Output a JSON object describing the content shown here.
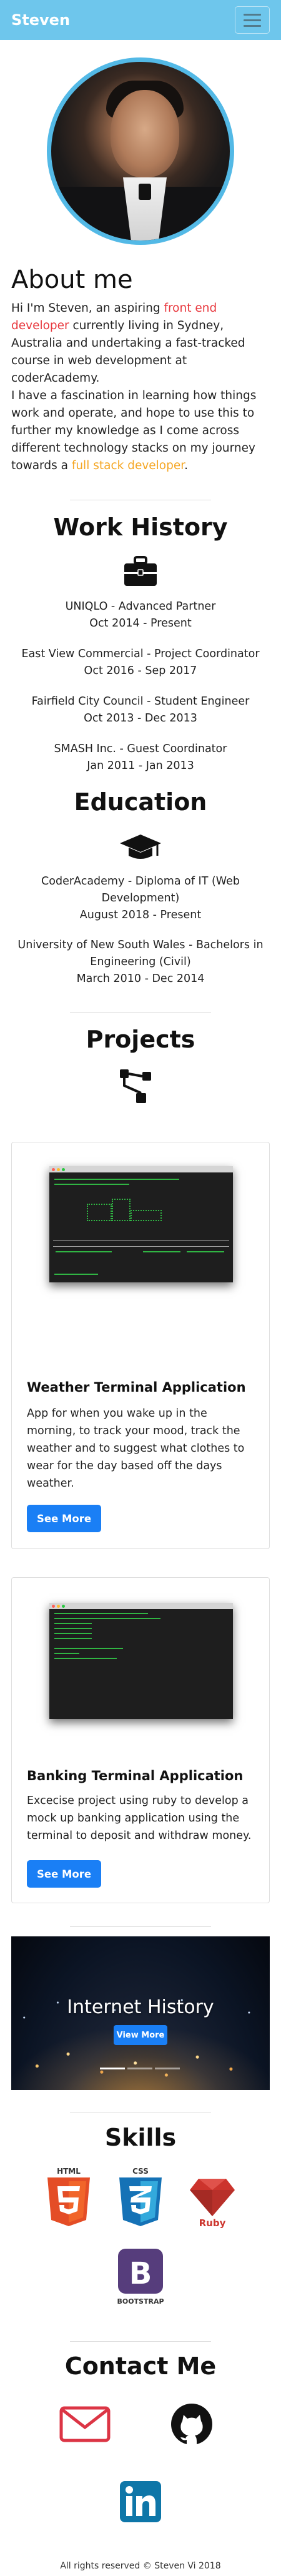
{
  "navbar": {
    "brand": "Steven"
  },
  "about": {
    "title": "About me",
    "p1_a": "Hi I'm Steven, an aspiring ",
    "p1_highlight": "front end developer",
    "p1_b": " currently living in Sydney, Australia and undertaking a fast-tracked course in web development at coderAcademy.",
    "p2_a": "I have a fascination in learning how things work and operate, and hope to use this to further my knowledge as I come across different technology stacks on my journey towards a ",
    "p2_highlight": "full stack developer",
    "p2_b": "."
  },
  "work": {
    "title": "Work History",
    "icon": "briefcase-icon",
    "jobs": [
      {
        "role": "UNIQLO - Advanced Partner",
        "dates": "Oct 2014 - Present"
      },
      {
        "role": "East View Commercial - Project Coordinator",
        "dates": "Oct 2016 - Sep 2017"
      },
      {
        "role": "Fairfield City Council - Student Engineer",
        "dates": "Oct 2013 - Dec 2013"
      },
      {
        "role": "SMASH Inc. - Guest Coordinator",
        "dates": "Jan 2011 - Jan 2013"
      }
    ]
  },
  "education": {
    "title": "Education",
    "icon": "graduation-cap-icon",
    "items": [
      {
        "school_1": "CoderAcademy - Diploma of IT (Web",
        "school_2": "Development)",
        "dates": "August 2018 - Present"
      },
      {
        "school_1": "University of New South Wales - Bachelors in",
        "school_2": "Engineering (Civil)",
        "dates": "March 2010 - Dec 2014"
      }
    ]
  },
  "projects": {
    "title": "Projects",
    "icon": "sitemap-icon",
    "items": [
      {
        "title": "Weather Terminal Application",
        "description": "App for when you wake up in the morning, to track your mood, track the weather and to suggest what clothes to wear for the day based off the days weather.",
        "button": "See More"
      },
      {
        "title": "Banking Terminal Application",
        "description": "Excecise project using ruby to develop a mock up banking application using the terminal to deposit and withdraw money.",
        "button": "See More"
      }
    ]
  },
  "banner": {
    "title": "Internet History",
    "button": "View More"
  },
  "skills": {
    "title": "Skills",
    "items": [
      {
        "name": "HTML",
        "icon": "html5-icon",
        "color": "#e44d26"
      },
      {
        "name": "CSS",
        "icon": "css3-icon",
        "color": "#1572b6"
      },
      {
        "name": "Ruby",
        "icon": "ruby-icon",
        "color": "#cc342d"
      },
      {
        "name": "BOOTSTRAP",
        "icon": "bootstrap-icon",
        "color": "#563d7c"
      }
    ]
  },
  "contact": {
    "title": "Contact Me",
    "items": [
      {
        "icon": "envelope-icon",
        "color": "#dc3545"
      },
      {
        "icon": "github-icon",
        "color": "#111111"
      },
      {
        "icon": "linkedin-icon",
        "color": "#0e76a8"
      }
    ]
  },
  "footer": {
    "text": "All rights reserved © Steven Vi 2018"
  },
  "colors": {
    "navbar": "#6ec6ec",
    "accent_blue": "#1a7ff5",
    "highlight_red": "#e8373d",
    "highlight_orange": "#f5a623"
  }
}
